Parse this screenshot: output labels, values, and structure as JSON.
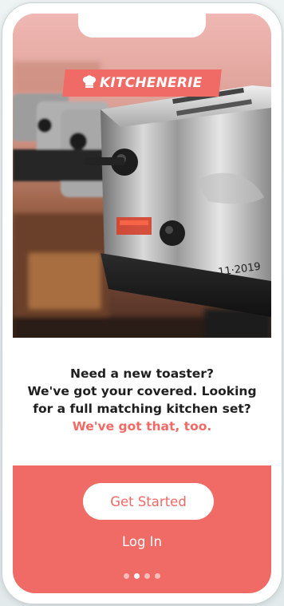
{
  "brand": {
    "name": "KITCHENERIE",
    "icon": "chef-hat-icon"
  },
  "hero": {
    "image": "toasters-row-photo",
    "engraving": "11·2019"
  },
  "message": {
    "line1": "Need a new toaster?",
    "line2": "We've got your covered. Looking",
    "line3": "for a full matching kitchen set?",
    "accent_line": "We've got that, too."
  },
  "actions": {
    "get_started_label": "Get Started",
    "login_label": "Log In"
  },
  "pagination": {
    "total": 4,
    "active_index": 1
  },
  "colors": {
    "accent": "#f06a66",
    "text": "#1f1f1f",
    "button_bg": "#ffffff"
  }
}
